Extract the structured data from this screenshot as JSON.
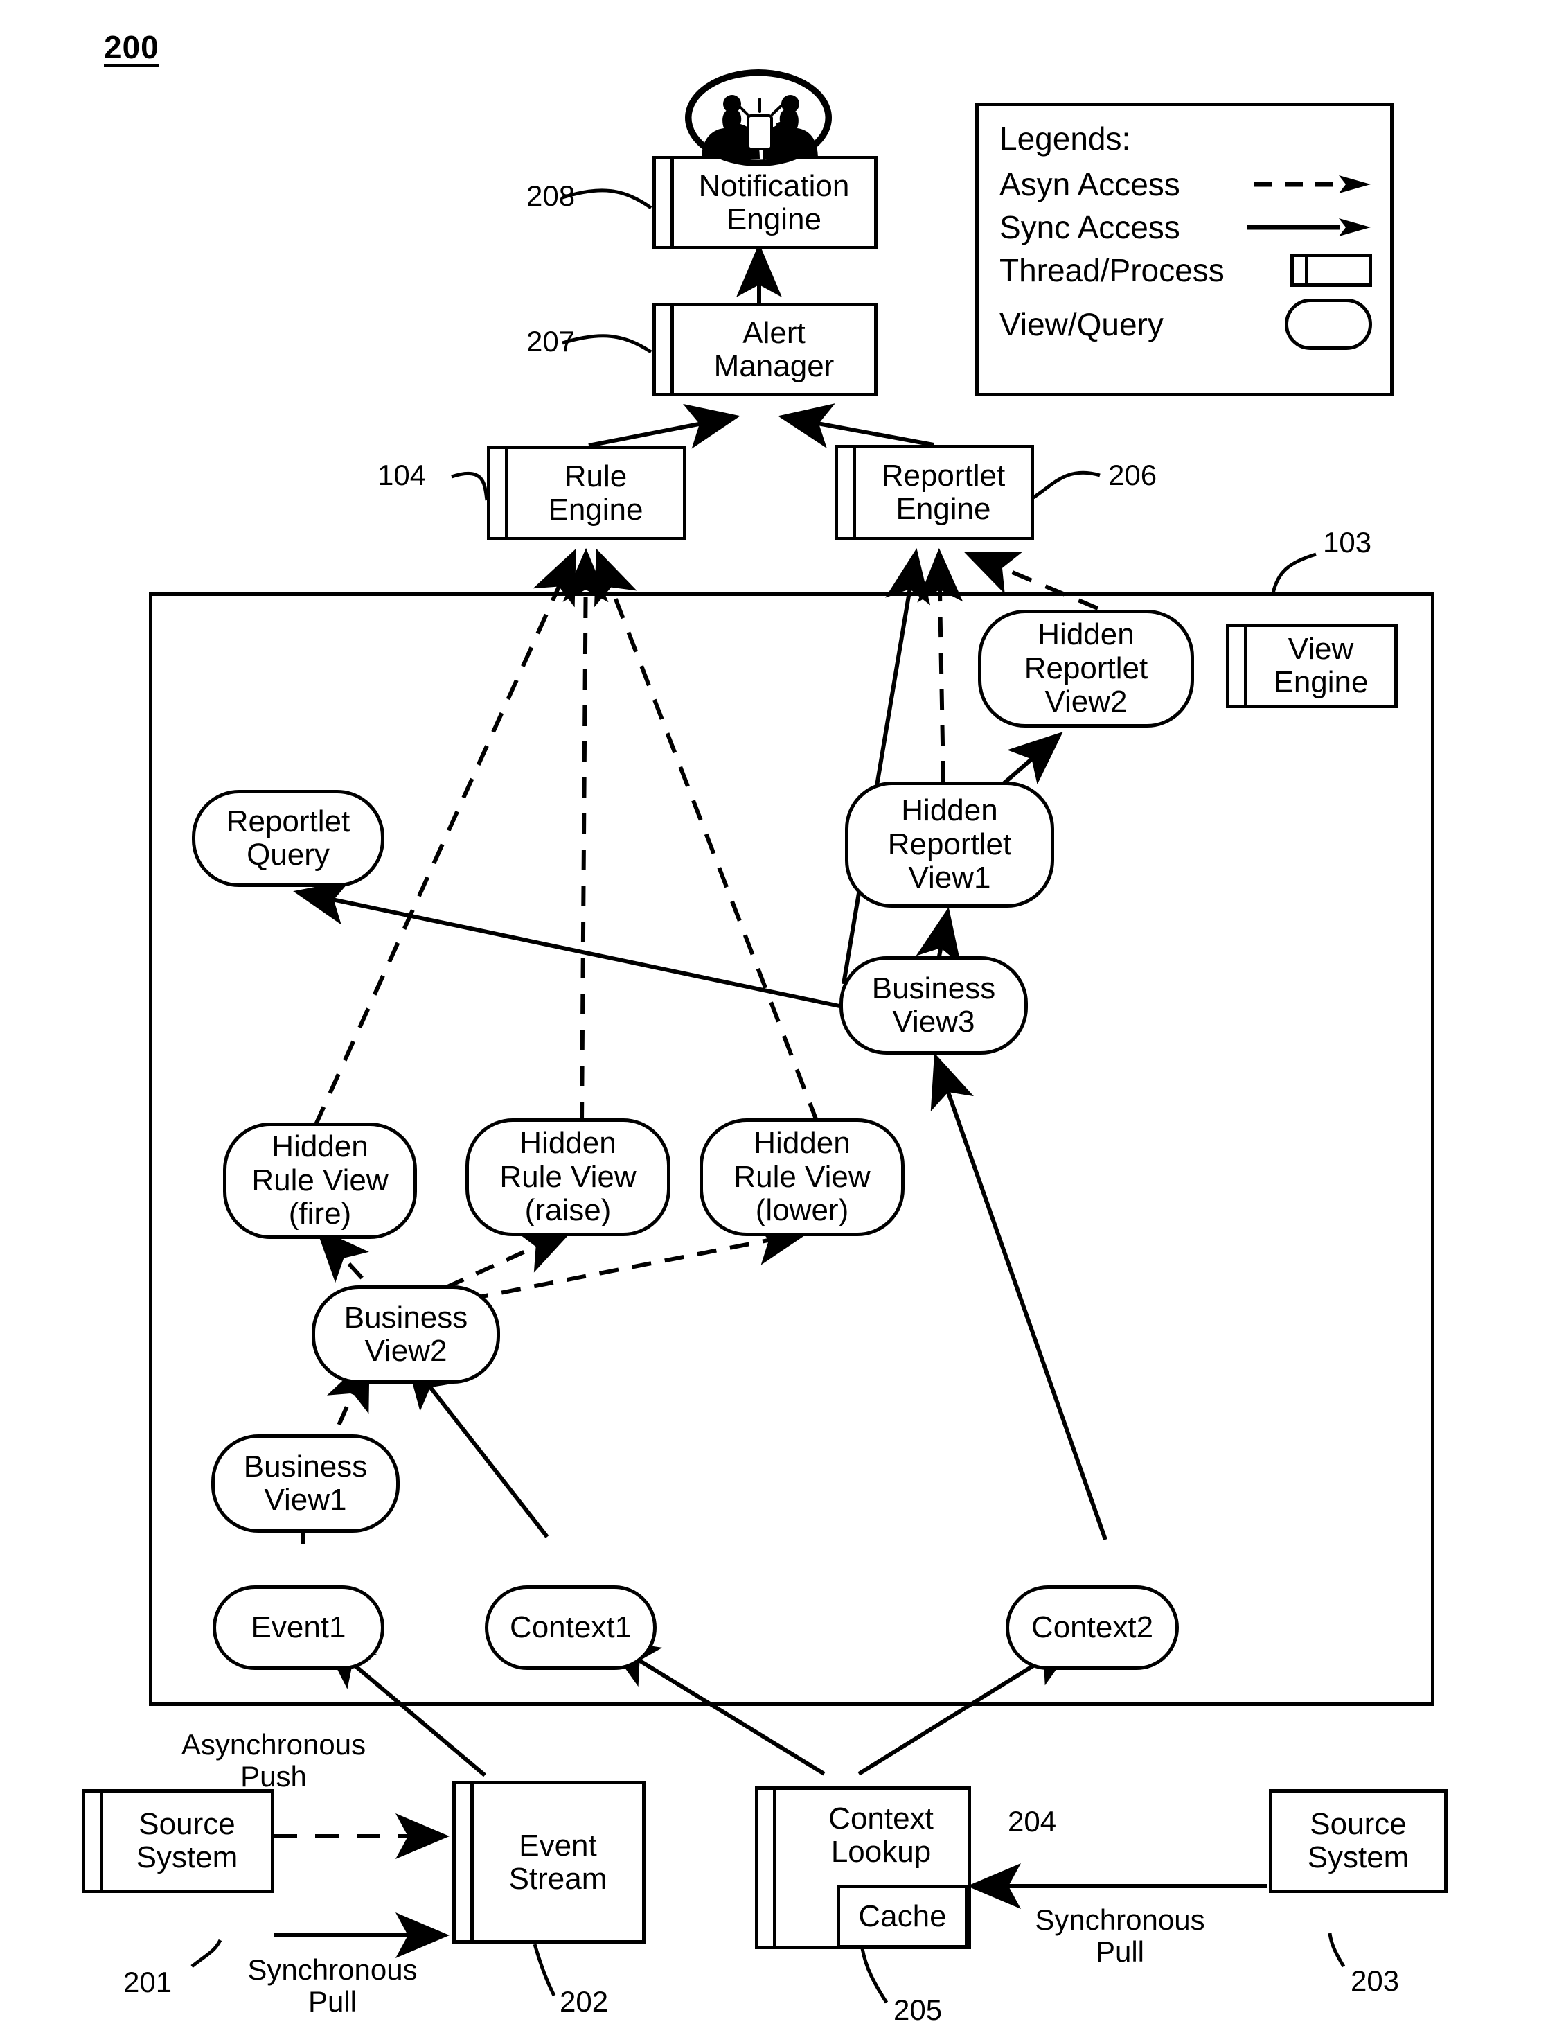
{
  "figure": {
    "number": "200"
  },
  "legend": {
    "title": "Legends:",
    "rows": [
      {
        "label": "Asyn Access",
        "symbol": "dashed-arrow-icon"
      },
      {
        "label": "Sync Access",
        "symbol": "solid-arrow-icon"
      },
      {
        "label": "Thread/Process",
        "symbol": "process-box-icon"
      },
      {
        "label": "View/Query",
        "symbol": "rounded-view-icon"
      }
    ]
  },
  "nodes": {
    "notification_engine": {
      "label": "Notification\nEngine",
      "ref": "208",
      "type": "thread-process"
    },
    "alert_manager": {
      "label": "Alert\nManager",
      "ref": "207",
      "type": "thread-process"
    },
    "rule_engine": {
      "label": "Rule\nEngine",
      "ref": "104",
      "type": "thread-process"
    },
    "reportlet_engine": {
      "label": "Reportlet\nEngine",
      "ref": "206",
      "type": "thread-process"
    },
    "view_engine": {
      "label": "View\nEngine",
      "ref": "",
      "type": "thread-process"
    },
    "container": {
      "ref": "103"
    },
    "hidden_reportlet_view2": {
      "label": "Hidden\nReportlet\nView2",
      "type": "view-query"
    },
    "hidden_reportlet_view1": {
      "label": "Hidden\nReportlet\nView1",
      "type": "view-query"
    },
    "reportlet_query": {
      "label": "Reportlet\nQuery",
      "type": "view-query"
    },
    "business_view3": {
      "label": "Business\nView3",
      "type": "view-query"
    },
    "hidden_rule_view_fire": {
      "label": "Hidden\nRule View\n(fire)",
      "type": "view-query"
    },
    "hidden_rule_view_raise": {
      "label": "Hidden\nRule View\n(raise)",
      "type": "view-query"
    },
    "hidden_rule_view_lower": {
      "label": "Hidden\nRule View\n(lower)",
      "type": "view-query"
    },
    "business_view2": {
      "label": "Business\nView2",
      "type": "view-query"
    },
    "business_view1": {
      "label": "Business\nView1",
      "type": "view-query"
    },
    "event1": {
      "label": "Event1",
      "type": "view-query"
    },
    "context1": {
      "label": "Context1",
      "type": "view-query"
    },
    "context2": {
      "label": "Context2",
      "type": "view-query"
    },
    "source_system_left": {
      "label": "Source\nSystem",
      "ref": "201",
      "type": "thread-process"
    },
    "event_stream": {
      "label": "Event\nStream",
      "ref": "202",
      "type": "thread-process"
    },
    "context_lookup": {
      "label": "Context\nLookup",
      "ref": "204",
      "type": "thread-process"
    },
    "cache": {
      "label": "Cache",
      "ref": "205",
      "type": "box"
    },
    "source_system_right": {
      "label": "Source\nSystem",
      "ref": "203",
      "type": "box"
    }
  },
  "annotations": {
    "asynchronous_push": "Asynchronous\nPush",
    "synchronous_pull_left": "Synchronous\nPull",
    "synchronous_pull_right": "Synchronous\nPull"
  }
}
